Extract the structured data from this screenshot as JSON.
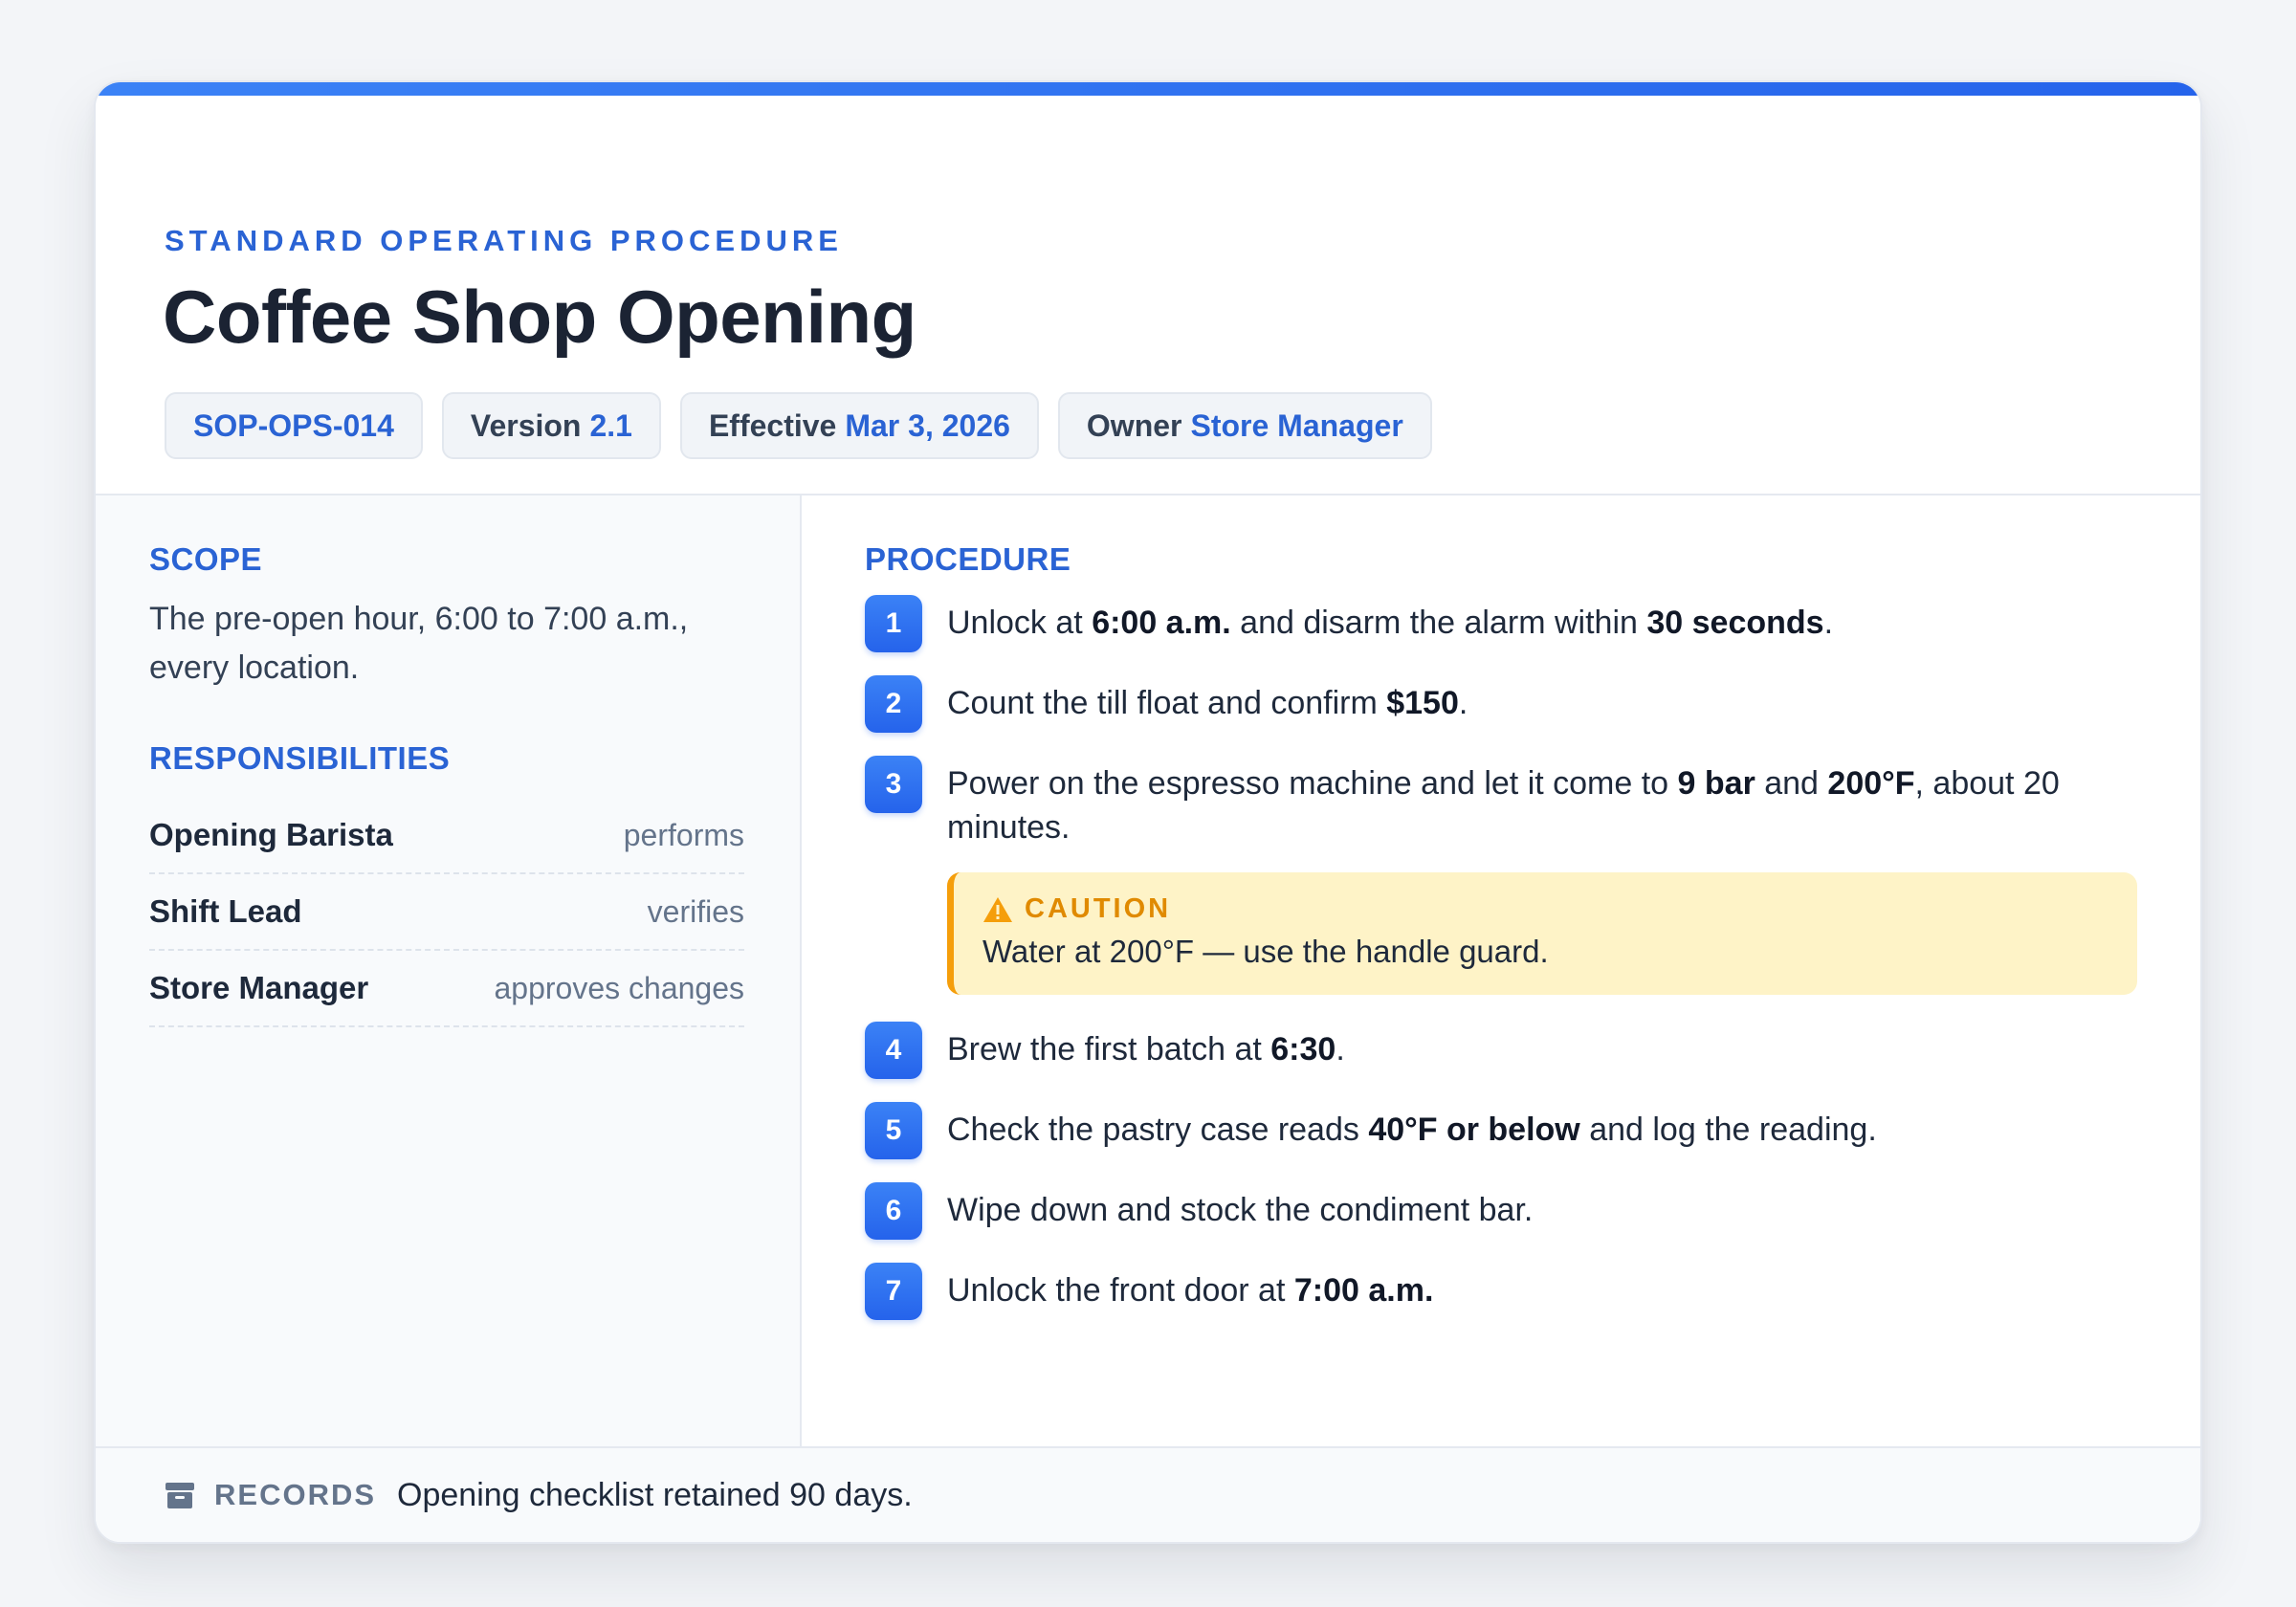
{
  "header": {
    "eyebrow": "STANDARD OPERATING PROCEDURE",
    "title": "Coffee Shop Opening",
    "chips": {
      "id": "SOP-OPS-014",
      "version_label": "Version",
      "version_value": "2.1",
      "effective_label": "Effective",
      "effective_value": "Mar 3, 2026",
      "owner_label": "Owner",
      "owner_value": "Store Manager"
    }
  },
  "scope": {
    "label": "SCOPE",
    "text": "The pre-open hour, 6:00 to 7:00 a.m., every location."
  },
  "responsibilities": {
    "label": "RESPONSIBILITIES",
    "items": [
      {
        "role": "Opening Barista",
        "action": "performs"
      },
      {
        "role": "Shift Lead",
        "action": "verifies"
      },
      {
        "role": "Store Manager",
        "action": "approves changes"
      }
    ]
  },
  "procedure": {
    "label": "PROCEDURE",
    "steps": [
      {
        "num": "1",
        "t1": "Unlock at ",
        "b1": "6:00 a.m.",
        "t2": " and disarm the alarm within ",
        "b2": "30 seconds",
        "t3": "."
      },
      {
        "num": "2",
        "t1": "Count the till float and confirm ",
        "b1": "$150",
        "t2": "."
      },
      {
        "num": "3",
        "t1": "Power on the espresso machine and let it come to ",
        "b1": "9 bar",
        "t2": " and ",
        "b2": "200°F",
        "t3": ", about 20 minutes."
      },
      {
        "num": "4",
        "t1": "Brew the first batch at ",
        "b1": "6:30",
        "t2": "."
      },
      {
        "num": "5",
        "t1": "Check the pastry case reads ",
        "b1": "40°F or below",
        "t2": " and log the reading."
      },
      {
        "num": "6",
        "t1": "Wipe down and stock the condiment bar."
      },
      {
        "num": "7",
        "t1": "Unlock the front door at ",
        "b1": "7:00 a.m.",
        "t2": ""
      }
    ],
    "caution": {
      "label": "CAUTION",
      "text": "Water at 200°F — use the handle guard."
    }
  },
  "footer": {
    "label": "RECORDS",
    "text": "Opening checklist retained 90 days."
  },
  "colors": {
    "accent": "#2563eb",
    "caution_bg": "#fef3c7",
    "caution_border": "#f59e0b"
  },
  "icons": {
    "caution": "warning-triangle-icon",
    "records": "archive-box-icon"
  }
}
